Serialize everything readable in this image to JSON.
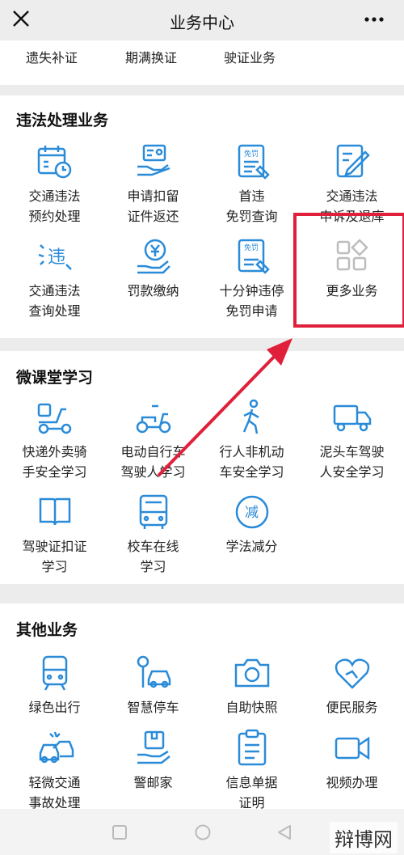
{
  "header": {
    "title": "业务中心",
    "close_icon": "close-icon",
    "more_icon": "more-dots-icon"
  },
  "top_row": {
    "items": [
      "遗失补证",
      "期满换证",
      "驶证业务"
    ]
  },
  "violation": {
    "title": "违法处理业务",
    "items": [
      {
        "label": "交通违法\n预约处理",
        "icon": "calendar-clock-icon"
      },
      {
        "label": "申请扣留\n证件返还",
        "icon": "card-hand-icon"
      },
      {
        "label": "首违\n免罚查询",
        "icon": "document-stamp-icon"
      },
      {
        "label": "交通违法\n申诉及退库",
        "icon": "edit-document-icon"
      },
      {
        "label": "交通违法\n查询处理",
        "icon": "violation-search-icon"
      },
      {
        "label": "罚款缴纳",
        "icon": "yuan-hand-icon"
      },
      {
        "label": "十分钟违停\n免罚申请",
        "icon": "ten-minute-parking-icon"
      },
      {
        "label": "更多业务",
        "icon": "grid-more-icon"
      }
    ]
  },
  "study": {
    "title": "微课堂学习",
    "items": [
      {
        "label": "快递外卖骑\n手安全学习",
        "icon": "delivery-scooter-icon"
      },
      {
        "label": "电动自行车\n驾驶人学习",
        "icon": "e-bike-icon"
      },
      {
        "label": "行人非机动\n车安全学习",
        "icon": "pedestrian-icon"
      },
      {
        "label": "泥头车驾驶\n人安全学习",
        "icon": "truck-icon"
      },
      {
        "label": "驾驶证扣证\n学习",
        "icon": "book-icon"
      },
      {
        "label": "校车在线\n学习",
        "icon": "bus-icon"
      },
      {
        "label": "学法减分",
        "icon": "reduce-points-icon",
        "badge": "减"
      }
    ]
  },
  "other": {
    "title": "其他业务",
    "items": [
      {
        "label": "绿色出行",
        "icon": "train-icon"
      },
      {
        "label": "智慧停车",
        "icon": "parking-car-icon"
      },
      {
        "label": "自助快照",
        "icon": "camera-icon"
      },
      {
        "label": "便民服务",
        "icon": "heart-icon"
      },
      {
        "label": "轻微交通\n事故处理",
        "icon": "car-accident-icon"
      },
      {
        "label": "警邮家",
        "icon": "package-hand-icon"
      },
      {
        "label": "信息单据\n证明",
        "icon": "clipboard-icon"
      },
      {
        "label": "视频办理",
        "icon": "video-camera-icon"
      }
    ]
  },
  "watermark": "辩博网",
  "colors": {
    "accent": "#2a8bd8",
    "highlight_red": "#e0203a",
    "muted_icon": "#bdbdbd"
  }
}
